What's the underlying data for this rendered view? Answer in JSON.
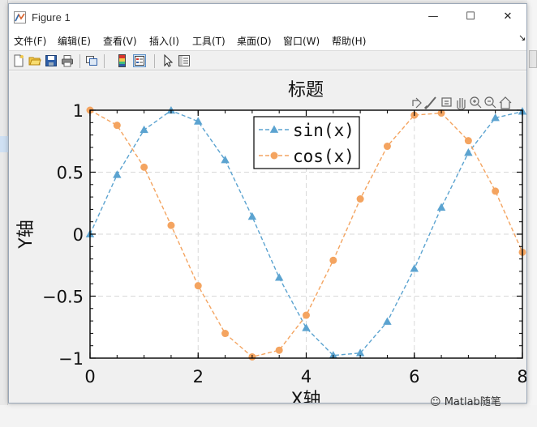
{
  "window": {
    "title": "Figure 1",
    "minimize_glyph": "—",
    "maximize_glyph": "☐",
    "close_glyph": "✕"
  },
  "menubar": {
    "items": [
      {
        "label": "文件(F)"
      },
      {
        "label": "编辑(E)"
      },
      {
        "label": "查看(V)"
      },
      {
        "label": "插入(I)"
      },
      {
        "label": "工具(T)"
      },
      {
        "label": "桌面(D)"
      },
      {
        "label": "窗口(W)"
      },
      {
        "label": "帮助(H)"
      }
    ],
    "overflow_glyph": "↘"
  },
  "toolbar": {
    "icons": [
      "new-file-icon",
      "open-folder-icon",
      "save-icon",
      "print-icon",
      "link-figure-icon",
      "colorbar-icon",
      "legend-icon",
      "pointer-icon",
      "property-inspector-icon"
    ]
  },
  "axes_toolbar": {
    "icons": [
      "export-icon",
      "brush-icon",
      "data-tip-icon",
      "pan-icon",
      "zoom-in-icon",
      "zoom-out-icon",
      "restore-view-icon"
    ]
  },
  "colors": {
    "sin": "#5ba3d0",
    "cos": "#f4a460",
    "grid": "#d9d9d9",
    "axes": "#000000"
  },
  "chart_data": {
    "type": "line",
    "title": "标题",
    "xlabel": "X轴",
    "ylabel": "Y轴",
    "xlim": [
      0,
      8
    ],
    "ylim": [
      -1,
      1
    ],
    "xticks": [
      0,
      2,
      4,
      6,
      8
    ],
    "yticks": [
      -1,
      -0.5,
      0,
      0.5,
      1
    ],
    "ytick_labels": [
      "−1",
      "−0.5",
      "0",
      "0.5",
      "1"
    ],
    "xtick_labels": [
      "0",
      "2",
      "4",
      "6",
      "8"
    ],
    "grid": true,
    "legend_location": "top-center",
    "x": [
      0,
      0.5,
      1,
      1.5,
      2,
      2.5,
      3,
      3.5,
      4,
      4.5,
      5,
      5.5,
      6,
      6.5,
      7,
      7.5,
      8
    ],
    "series": [
      {
        "name": "sin(x)",
        "marker": "triangle",
        "line_style": "dashed",
        "values": [
          0,
          0.479,
          0.841,
          0.997,
          0.909,
          0.598,
          0.141,
          -0.351,
          -0.757,
          -0.978,
          -0.959,
          -0.706,
          -0.279,
          0.215,
          0.657,
          0.938,
          0.989
        ]
      },
      {
        "name": "cos(x)",
        "marker": "circle",
        "line_style": "dashed",
        "values": [
          1,
          0.878,
          0.54,
          0.071,
          -0.416,
          -0.801,
          -0.99,
          -0.936,
          -0.654,
          -0.211,
          0.284,
          0.709,
          0.96,
          0.977,
          0.754,
          0.347,
          -0.146
        ]
      }
    ]
  },
  "watermark": {
    "text": "Matlab随笔"
  }
}
